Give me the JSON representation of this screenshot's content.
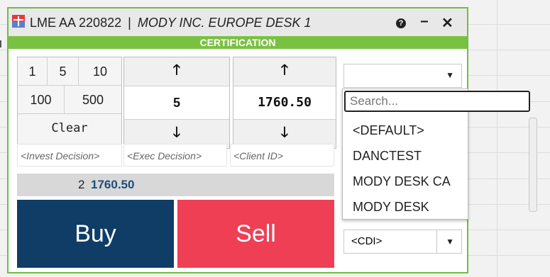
{
  "window": {
    "title_symbol": "LME AA 220822",
    "title_separator": "|",
    "title_desk": "MODY INC. EUROPE DESK 1",
    "help_icon": "?",
    "minimize_icon": "−",
    "close_icon": "✕",
    "environment_banner": "CERTIFICATION"
  },
  "quantity_presets": {
    "buttons": [
      "1",
      "5",
      "10",
      "100",
      "500"
    ],
    "clear_label": "Clear"
  },
  "quantity_spinner": {
    "value": "5",
    "up_icon": "arrow-up-icon",
    "down_icon": "arrow-down-icon"
  },
  "price_spinner": {
    "value": "1760.50",
    "up_icon": "arrow-up-icon",
    "down_icon": "arrow-down-icon"
  },
  "fields": {
    "invest_decision_placeholder": "<Invest Decision>",
    "exec_decision_placeholder": "<Exec Decision>",
    "client_id_placeholder": "<Client ID>"
  },
  "summary": {
    "count": "2",
    "price": "1760.50"
  },
  "actions": {
    "buy_label": "Buy",
    "sell_label": "Sell"
  },
  "account_select": {
    "value": "",
    "search_placeholder": "Search...",
    "options": [
      "<DEFAULT>",
      "DANCTEST",
      "MODY DESK CA",
      "MODY DESK"
    ]
  },
  "cdi_select": {
    "value": "<CDI>"
  },
  "colors": {
    "window_border": "#6fbe44",
    "banner": "#7ac142",
    "buy": "#0f3d66",
    "sell": "#ef3f55",
    "price_text": "#1f4e79"
  }
}
